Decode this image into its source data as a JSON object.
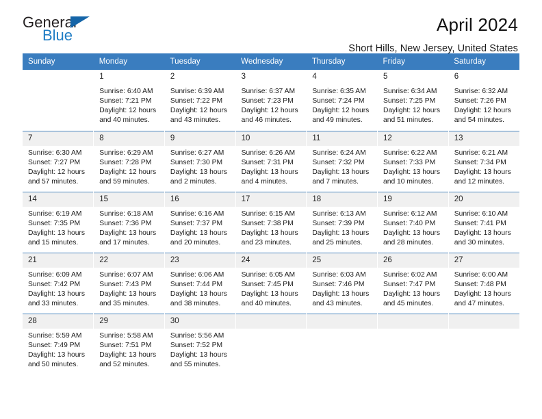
{
  "brand": {
    "name_part1": "General",
    "name_part2": "Blue",
    "triangle_color": "#1565a8",
    "blue_color": "#1f7cc4"
  },
  "header": {
    "title": "April 2024",
    "subtitle": "Short Hills, New Jersey, United States",
    "header_bg": "#3a7dbf",
    "stripe_bg": "#f0f0f0"
  },
  "weekdays": [
    "Sunday",
    "Monday",
    "Tuesday",
    "Wednesday",
    "Thursday",
    "Friday",
    "Saturday"
  ],
  "weeks": [
    {
      "shaded": false,
      "days": [
        {
          "num": "",
          "info": ""
        },
        {
          "num": "1",
          "info": "Sunrise: 6:40 AM\nSunset: 7:21 PM\nDaylight: 12 hours\nand 40 minutes."
        },
        {
          "num": "2",
          "info": "Sunrise: 6:39 AM\nSunset: 7:22 PM\nDaylight: 12 hours\nand 43 minutes."
        },
        {
          "num": "3",
          "info": "Sunrise: 6:37 AM\nSunset: 7:23 PM\nDaylight: 12 hours\nand 46 minutes."
        },
        {
          "num": "4",
          "info": "Sunrise: 6:35 AM\nSunset: 7:24 PM\nDaylight: 12 hours\nand 49 minutes."
        },
        {
          "num": "5",
          "info": "Sunrise: 6:34 AM\nSunset: 7:25 PM\nDaylight: 12 hours\nand 51 minutes."
        },
        {
          "num": "6",
          "info": "Sunrise: 6:32 AM\nSunset: 7:26 PM\nDaylight: 12 hours\nand 54 minutes."
        }
      ]
    },
    {
      "shaded": true,
      "days": [
        {
          "num": "7",
          "info": "Sunrise: 6:30 AM\nSunset: 7:27 PM\nDaylight: 12 hours\nand 57 minutes."
        },
        {
          "num": "8",
          "info": "Sunrise: 6:29 AM\nSunset: 7:28 PM\nDaylight: 12 hours\nand 59 minutes."
        },
        {
          "num": "9",
          "info": "Sunrise: 6:27 AM\nSunset: 7:30 PM\nDaylight: 13 hours\nand 2 minutes."
        },
        {
          "num": "10",
          "info": "Sunrise: 6:26 AM\nSunset: 7:31 PM\nDaylight: 13 hours\nand 4 minutes."
        },
        {
          "num": "11",
          "info": "Sunrise: 6:24 AM\nSunset: 7:32 PM\nDaylight: 13 hours\nand 7 minutes."
        },
        {
          "num": "12",
          "info": "Sunrise: 6:22 AM\nSunset: 7:33 PM\nDaylight: 13 hours\nand 10 minutes."
        },
        {
          "num": "13",
          "info": "Sunrise: 6:21 AM\nSunset: 7:34 PM\nDaylight: 13 hours\nand 12 minutes."
        }
      ]
    },
    {
      "shaded": true,
      "days": [
        {
          "num": "14",
          "info": "Sunrise: 6:19 AM\nSunset: 7:35 PM\nDaylight: 13 hours\nand 15 minutes."
        },
        {
          "num": "15",
          "info": "Sunrise: 6:18 AM\nSunset: 7:36 PM\nDaylight: 13 hours\nand 17 minutes."
        },
        {
          "num": "16",
          "info": "Sunrise: 6:16 AM\nSunset: 7:37 PM\nDaylight: 13 hours\nand 20 minutes."
        },
        {
          "num": "17",
          "info": "Sunrise: 6:15 AM\nSunset: 7:38 PM\nDaylight: 13 hours\nand 23 minutes."
        },
        {
          "num": "18",
          "info": "Sunrise: 6:13 AM\nSunset: 7:39 PM\nDaylight: 13 hours\nand 25 minutes."
        },
        {
          "num": "19",
          "info": "Sunrise: 6:12 AM\nSunset: 7:40 PM\nDaylight: 13 hours\nand 28 minutes."
        },
        {
          "num": "20",
          "info": "Sunrise: 6:10 AM\nSunset: 7:41 PM\nDaylight: 13 hours\nand 30 minutes."
        }
      ]
    },
    {
      "shaded": true,
      "days": [
        {
          "num": "21",
          "info": "Sunrise: 6:09 AM\nSunset: 7:42 PM\nDaylight: 13 hours\nand 33 minutes."
        },
        {
          "num": "22",
          "info": "Sunrise: 6:07 AM\nSunset: 7:43 PM\nDaylight: 13 hours\nand 35 minutes."
        },
        {
          "num": "23",
          "info": "Sunrise: 6:06 AM\nSunset: 7:44 PM\nDaylight: 13 hours\nand 38 minutes."
        },
        {
          "num": "24",
          "info": "Sunrise: 6:05 AM\nSunset: 7:45 PM\nDaylight: 13 hours\nand 40 minutes."
        },
        {
          "num": "25",
          "info": "Sunrise: 6:03 AM\nSunset: 7:46 PM\nDaylight: 13 hours\nand 43 minutes."
        },
        {
          "num": "26",
          "info": "Sunrise: 6:02 AM\nSunset: 7:47 PM\nDaylight: 13 hours\nand 45 minutes."
        },
        {
          "num": "27",
          "info": "Sunrise: 6:00 AM\nSunset: 7:48 PM\nDaylight: 13 hours\nand 47 minutes."
        }
      ]
    },
    {
      "shaded": true,
      "days": [
        {
          "num": "28",
          "info": "Sunrise: 5:59 AM\nSunset: 7:49 PM\nDaylight: 13 hours\nand 50 minutes."
        },
        {
          "num": "29",
          "info": "Sunrise: 5:58 AM\nSunset: 7:51 PM\nDaylight: 13 hours\nand 52 minutes."
        },
        {
          "num": "30",
          "info": "Sunrise: 5:56 AM\nSunset: 7:52 PM\nDaylight: 13 hours\nand 55 minutes."
        },
        {
          "num": "",
          "info": ""
        },
        {
          "num": "",
          "info": ""
        },
        {
          "num": "",
          "info": ""
        },
        {
          "num": "",
          "info": ""
        }
      ]
    }
  ]
}
